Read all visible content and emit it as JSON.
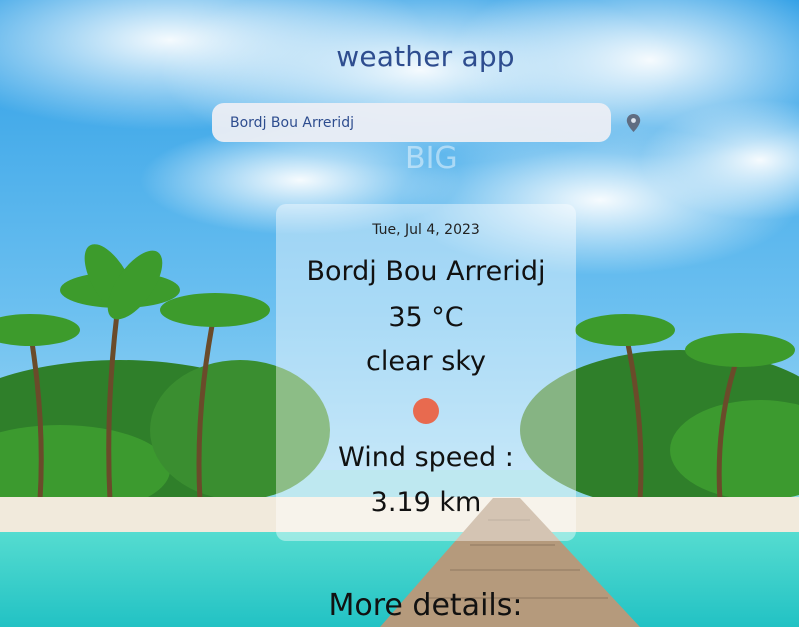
{
  "header": {
    "title": "weather app"
  },
  "search": {
    "value": "Bordj Bou Arreridj",
    "location_icon": "map-pin-icon"
  },
  "weather": {
    "date": "Tue, Jul 4, 2023",
    "city": "Bordj Bou Arreridj",
    "temperature": "35 °C",
    "description": "clear sky",
    "condition_icon": "sun-icon",
    "wind_label": "Wind speed :",
    "wind_value": "3.19 km"
  },
  "details": {
    "heading": "More details:"
  },
  "colors": {
    "title": "#2e4d8f",
    "sun": "#e86a4f",
    "sky_top": "#2f9fe6",
    "sea": "#2fd0c5"
  },
  "background": {
    "watermark": "BIG"
  }
}
